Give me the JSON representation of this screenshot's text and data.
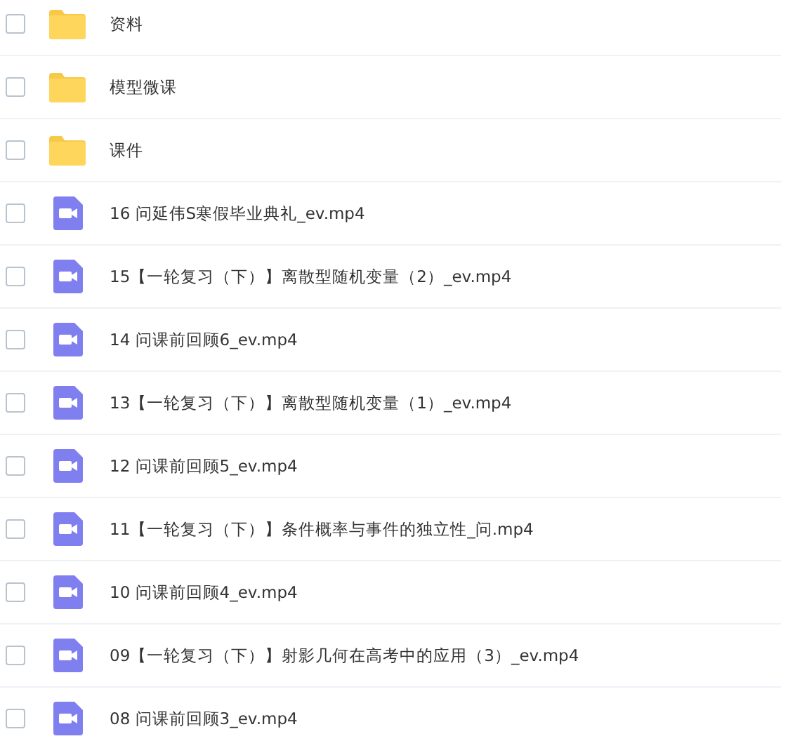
{
  "files": [
    {
      "kind": "folder",
      "name": "资料",
      "checked": false
    },
    {
      "kind": "folder",
      "name": "模型微课",
      "checked": false
    },
    {
      "kind": "folder",
      "name": "课件",
      "checked": false
    },
    {
      "kind": "video",
      "name": "16 问延伟S寒假毕业典礼_ev.mp4",
      "checked": false
    },
    {
      "kind": "video",
      "name": "15【一轮复习（下）】离散型随机变量（2）_ev.mp4",
      "checked": false
    },
    {
      "kind": "video",
      "name": "14 问课前回顾6_ev.mp4",
      "checked": false
    },
    {
      "kind": "video",
      "name": "13【一轮复习（下）】离散型随机变量（1）_ev.mp4",
      "checked": false
    },
    {
      "kind": "video",
      "name": "12 问课前回顾5_ev.mp4",
      "checked": false
    },
    {
      "kind": "video",
      "name": "11【一轮复习（下）】条件概率与事件的独立性_问.mp4",
      "checked": false
    },
    {
      "kind": "video",
      "name": "10 问课前回顾4_ev.mp4",
      "checked": false
    },
    {
      "kind": "video",
      "name": "09【一轮复习（下）】射影几何在高考中的应用（3）_ev.mp4",
      "checked": false
    },
    {
      "kind": "video",
      "name": "08 问课前回顾3_ev.mp4",
      "checked": false
    }
  ]
}
